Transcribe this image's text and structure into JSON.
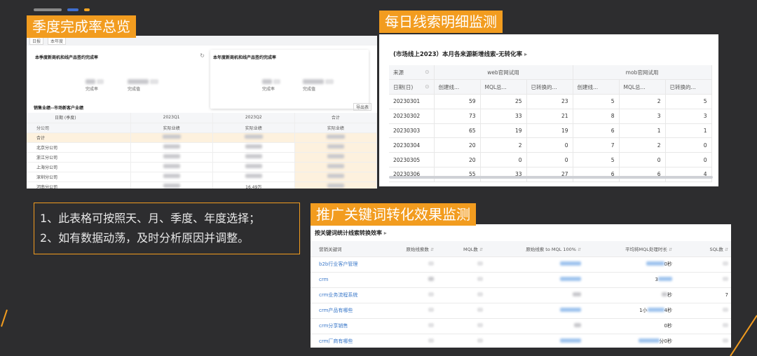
{
  "labels": {
    "quarterly": "季度完成率总览",
    "daily": "每日线索明细监测",
    "keyword": "推广关键词转化效果监测"
  },
  "note": {
    "line1": "1、此表格可按照天、月、季度、年度选择；",
    "line2": "2、如有数据动荡，及时分析原因并调整。"
  },
  "quarterly_panel": {
    "tabs": [
      "日报",
      "本年度"
    ],
    "card1_title": "本季度新商机和线产品签约完成率",
    "card2_title": "本年度新商机和线产品签约完成率",
    "metric_labels": [
      "完成率",
      "完成值"
    ],
    "section_title": "销售业绩--市场新客户业绩",
    "export_label": "导出表",
    "header1": [
      "日期 (季度)",
      "2023Q1",
      "2023Q2",
      "合计"
    ],
    "header2": [
      "分公司",
      "实际业绩",
      "实际业绩",
      "实际业绩"
    ],
    "rows": [
      "合计",
      "北京分公司",
      "浙江分公司",
      "上海分公司",
      "深圳分公司",
      "河南分公司"
    ],
    "visible_value": "16.49万"
  },
  "daily_panel": {
    "title": "(市场线上2023）本月各来源新增线索-无转化率",
    "source_label": "来源",
    "date_label": "日期(日)",
    "groups": [
      "web官网试用",
      "mob官网试用"
    ],
    "sub_headers": [
      "创建线...",
      "MQL总...",
      "已转换的...",
      "创建线...",
      "MQL总...",
      "已转换的..."
    ],
    "rows": [
      {
        "date": "20230301",
        "values": [
          "59",
          "25",
          "23",
          "5",
          "2",
          "5"
        ]
      },
      {
        "date": "20230302",
        "values": [
          "73",
          "33",
          "21",
          "8",
          "3",
          "3"
        ]
      },
      {
        "date": "20230303",
        "values": [
          "65",
          "19",
          "19",
          "6",
          "1",
          "1"
        ]
      },
      {
        "date": "20230304",
        "values": [
          "20",
          "2",
          "0",
          "7",
          "2",
          "0"
        ]
      },
      {
        "date": "20230305",
        "values": [
          "20",
          "0",
          "0",
          "5",
          "0",
          "0"
        ]
      },
      {
        "date": "20230306",
        "values": [
          "55",
          "33",
          "27",
          "6",
          "6",
          "4"
        ]
      }
    ]
  },
  "keyword_panel": {
    "title": "按关键词统计线索转换效率",
    "headers": [
      "营销关键词",
      "原始线索数",
      "MQL数",
      "原始线索 to MQL 100%",
      "平均将MQL处理时长",
      "SQL数"
    ],
    "keywords": [
      "b2b行业客户管理",
      "crm",
      "crm业务流程系统",
      "crm产品有哪些",
      "crm分享销售",
      "crm厂商有哪些"
    ],
    "visible_cells": [
      "0秒",
      "3",
      "秒",
      "1小",
      "4秒",
      "0秒",
      "分0秒",
      "7"
    ]
  }
}
